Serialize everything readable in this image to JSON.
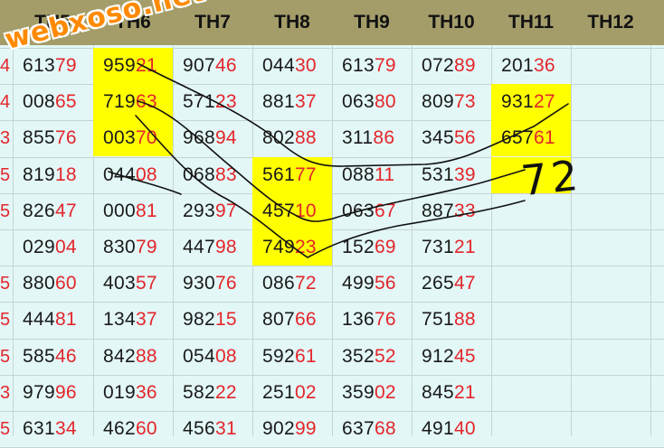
{
  "headers": [
    "TH5",
    "TH6",
    "TH7",
    "TH8",
    "TH9",
    "TH10",
    "TH11",
    "TH12"
  ],
  "left_edge": [
    "4",
    "4",
    "3",
    "5",
    "5",
    "",
    "5",
    "5",
    "5",
    "3",
    "5"
  ],
  "rows": [
    [
      "61379",
      "95921",
      "90746",
      "04430",
      "61379",
      "07289",
      "20136",
      ""
    ],
    [
      "00865",
      "71963",
      "57123",
      "88137",
      "06380",
      "80973",
      "93127",
      ""
    ],
    [
      "85576",
      "00370",
      "96894",
      "80288",
      "31186",
      "34556",
      "65761",
      ""
    ],
    [
      "81918",
      "04408",
      "06883",
      "56177",
      "08811",
      "53139",
      "",
      ""
    ],
    [
      "82647",
      "00081",
      "29397",
      "45710",
      "06367",
      "88733",
      "",
      ""
    ],
    [
      "02904",
      "83079",
      "44798",
      "74923",
      "15269",
      "73121",
      "",
      ""
    ],
    [
      "88060",
      "40357",
      "93076",
      "08672",
      "49956",
      "26547",
      "",
      ""
    ],
    [
      "44481",
      "13437",
      "98215",
      "80766",
      "13676",
      "75188",
      "",
      ""
    ],
    [
      "58546",
      "84288",
      "05408",
      "59261",
      "35252",
      "91245",
      "",
      ""
    ],
    [
      "97996",
      "01936",
      "58222",
      "25102",
      "35902",
      "84521",
      "",
      ""
    ],
    [
      "63134",
      "46260",
      "45631",
      "90299",
      "63768",
      "49140",
      "",
      ""
    ]
  ],
  "highlighted": [
    [
      0,
      1
    ],
    [
      1,
      1
    ],
    [
      2,
      1
    ],
    [
      3,
      3
    ],
    [
      4,
      3
    ],
    [
      5,
      3
    ],
    [
      1,
      6
    ],
    [
      2,
      6
    ],
    [
      3,
      6
    ]
  ],
  "watermark": "webxoso.net",
  "handwritten_note": "72",
  "colors": {
    "header_bg": "#a49d6a",
    "body_bg": "#e3f7f7",
    "highlight": "#ffff00",
    "digit_red": "#e3262a"
  }
}
